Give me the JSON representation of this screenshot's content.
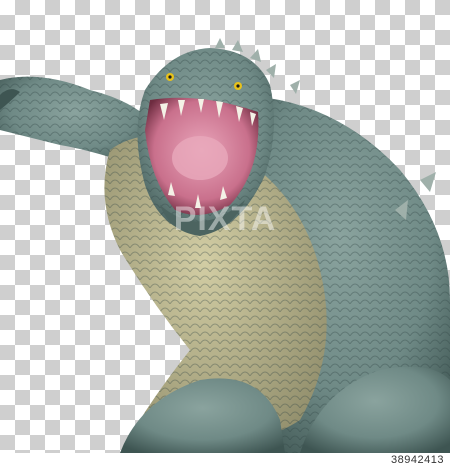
{
  "image": {
    "subject_icon": "reptile-monster-icon",
    "background": "transparency-checkerboard",
    "colors": {
      "skin": "#6f8a86",
      "skin_dark": "#3e5552",
      "belly": "#b9b58e",
      "mouth": "#d98aa4",
      "eye": "#e8c21a"
    }
  },
  "watermark": {
    "text": "PIXTA"
  },
  "footer": {
    "image_id": "38942413"
  }
}
